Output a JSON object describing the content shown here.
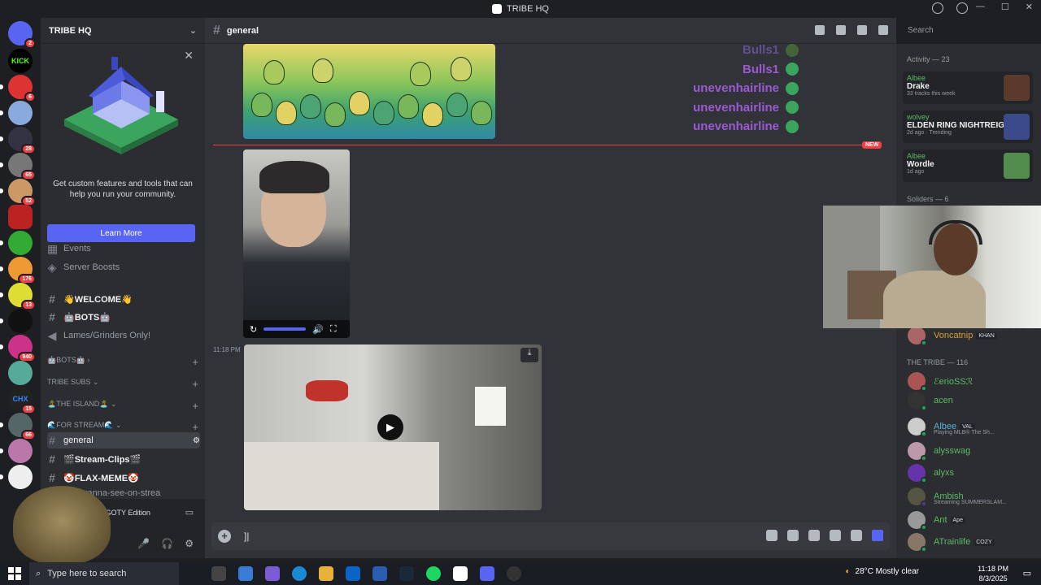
{
  "window": {
    "title": "TRIBE HQ"
  },
  "server": {
    "name": "TRIBE HQ"
  },
  "promo": {
    "text": "Get custom features and tools that can help you run your community.",
    "button": "Learn More"
  },
  "channels": {
    "events": "Events",
    "boosts": "Server Boosts",
    "welcome": "👋WELCOME👋",
    "bots": "🤖BOTS🤖",
    "lames": "Lames/Grinders Only!",
    "cat_bots": "🤖BOTS🤖",
    "cat_tribe": "TRIBE SUBS",
    "cat_island": "🏝️THE ISLAND🏝️",
    "cat_stream": "🌊FOR STREAM🌊",
    "general": "general",
    "stream_clips": "🎬Stream-Clips🎬",
    "flax_meme": "🤡FLAX-MEME🤡",
    "partial": "you-wanna-see-on-strea"
  },
  "user": {
    "activity": "n GOTY Edition"
  },
  "main": {
    "channel": "general",
    "names": [
      "Bulls1",
      "Bulls1",
      "unevenhairline",
      "unevenhairline",
      "unevenhairline"
    ],
    "new_tag": "NEW",
    "timestamp": "11:18 PM",
    "composer_value": "]|"
  },
  "search": {
    "placeholder": "Search"
  },
  "activity": {
    "header": "Activity — 23",
    "items": [
      {
        "who": "Albee",
        "what": "Drake",
        "sub": "33 tracks this week"
      },
      {
        "who": "wolvey",
        "what": "ELDEN RING NIGHTREIGN",
        "sub": "2d ago · Trending"
      },
      {
        "who": "Albee",
        "what": "Wordle",
        "sub": "1d ago"
      }
    ]
  },
  "members": {
    "soldiers_header": "Soliders — 6",
    "tribe_header": "THE TRIBE — 116",
    "voncatnip": {
      "name": "Voncatnip",
      "tag": "KHAN"
    },
    "list": [
      {
        "name": "ℰerioSSℛ",
        "tag": "",
        "status": ""
      },
      {
        "name": "acen",
        "tag": "",
        "status": ""
      },
      {
        "name": "Albee",
        "tag": "VAL",
        "status": "Playing MLB® The Sh..."
      },
      {
        "name": "alysswag",
        "tag": "",
        "status": ""
      },
      {
        "name": "alyxs",
        "tag": "",
        "status": ""
      },
      {
        "name": "Ambish",
        "tag": "",
        "status": "Streaming SUMMERSLAM..."
      },
      {
        "name": "Ant",
        "tag": "Ape",
        "status": ""
      },
      {
        "name": "ATrainlife",
        "tag": "COZY",
        "status": ""
      }
    ]
  },
  "taskbar": {
    "search": "Type here to search",
    "weather": "28°C  Mostly clear",
    "time": "11:18 PM",
    "date": "8/3/2025"
  },
  "servers": {
    "badges": [
      "2",
      "6",
      "28",
      "65",
      "52",
      "176",
      "13",
      "940",
      "15",
      "66"
    ]
  }
}
